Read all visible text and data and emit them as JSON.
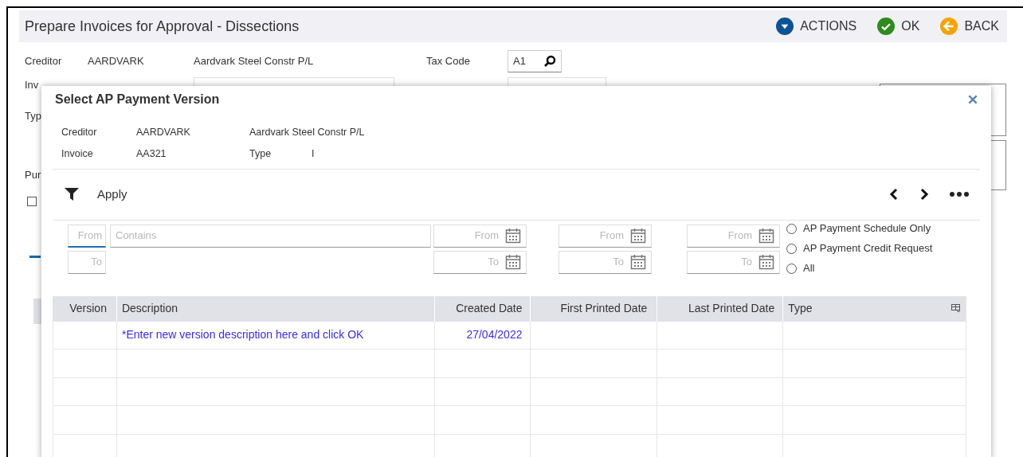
{
  "page": {
    "title": "Prepare Invoices for Approval - Dissections",
    "actions": [
      {
        "label": "ACTIONS",
        "kind": "actions"
      },
      {
        "label": "OK",
        "kind": "ok"
      },
      {
        "label": "BACK",
        "kind": "back"
      }
    ],
    "creditor": {
      "label": "Creditor",
      "code": "AARDVARK",
      "name": "Aardvark Steel Constr P/L"
    },
    "tax_code": {
      "label": "Tax Code",
      "value": "A1"
    },
    "partial_labels": [
      "Inv",
      "Typ",
      "Pur"
    ],
    "checkbox": {
      "checked": false
    }
  },
  "dialog": {
    "title": "Select AP Payment Version",
    "info": [
      {
        "label": "Creditor",
        "value": "AARDVARK",
        "label2": "Aardvark Steel Constr P/L"
      },
      {
        "label": "Invoice",
        "value": "AA321",
        "label2": "Type",
        "value2": "I"
      }
    ],
    "apply": "Apply",
    "version_filter": {
      "from": "From",
      "to": "To"
    },
    "description_filter": {
      "placeholder": "Contains"
    },
    "date_filters": [
      {
        "from": "From",
        "to": "To"
      },
      {
        "from": "From",
        "to": "To"
      },
      {
        "from": "From",
        "to": "To"
      }
    ],
    "radios": [
      {
        "label": "AP Payment Schedule Only",
        "selected": false
      },
      {
        "label": "AP Payment Credit Request",
        "selected": false
      },
      {
        "label": "All",
        "selected": false
      }
    ],
    "table": {
      "columns": [
        "Version",
        "Description",
        "Created Date",
        "First Printed Date",
        "Last Printed Date",
        "Type"
      ],
      "rows": [
        {
          "description": "*Enter new version description here and click OK",
          "created_date": "27/04/2022"
        }
      ]
    }
  }
}
